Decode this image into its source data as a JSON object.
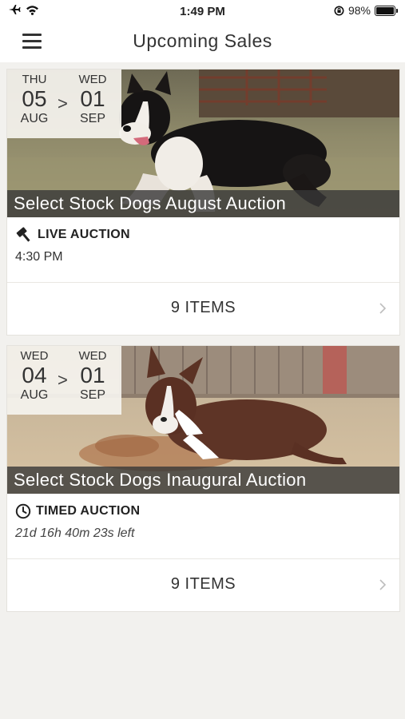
{
  "status_bar": {
    "time": "1:49 PM",
    "battery_text": "98%",
    "battery_level": 0.98
  },
  "header": {
    "title": "Upcoming Sales"
  },
  "sales": [
    {
      "start": {
        "dow": "THU",
        "day": "05",
        "month": "AUG"
      },
      "end": {
        "dow": "WED",
        "day": "01",
        "month": "SEP"
      },
      "arrow": ">",
      "title": "Select Stock Dogs August Auction",
      "type_label": "LIVE AUCTION",
      "type_icon": "gavel-icon",
      "subtext": "4:30 PM",
      "items_label": "9 ITEMS"
    },
    {
      "start": {
        "dow": "WED",
        "day": "04",
        "month": "AUG"
      },
      "end": {
        "dow": "WED",
        "day": "01",
        "month": "SEP"
      },
      "arrow": ">",
      "title": "Select Stock Dogs Inaugural Auction",
      "type_label": "TIMED AUCTION",
      "type_icon": "clock-icon",
      "subtext": "21d 16h 40m 23s left",
      "items_label": "9 ITEMS"
    }
  ]
}
